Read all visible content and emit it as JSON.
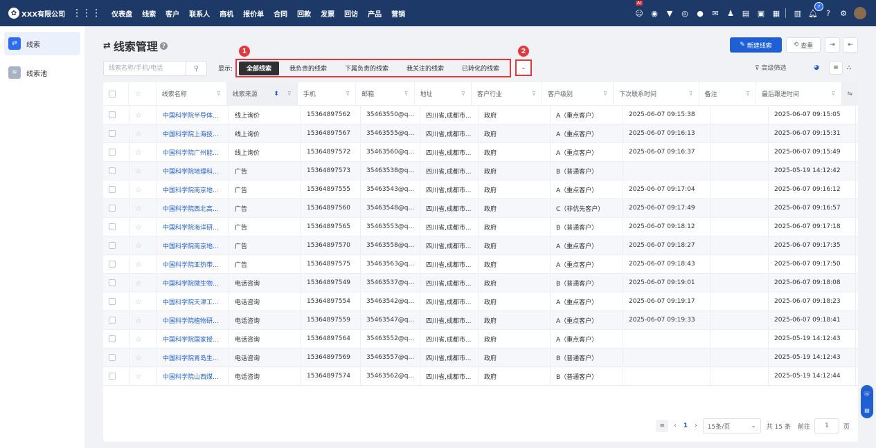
{
  "header": {
    "company": "XXX有限公司",
    "nav": [
      "仪表盘",
      "线索",
      "客户",
      "联系人",
      "商机",
      "报价单",
      "合同",
      "回款",
      "发票",
      "回访",
      "产品",
      "营销"
    ],
    "ai_badge": "AI",
    "notify_count": "7"
  },
  "sidebar": {
    "items": [
      {
        "label": "线索",
        "icon": "clue-icon",
        "active": true
      },
      {
        "label": "线索池",
        "icon": "pool-icon",
        "active": false
      }
    ]
  },
  "page": {
    "title": "线索管理",
    "new_label": "新建线索",
    "check_label": "查重",
    "search_placeholder": "线索名称/手机/电话",
    "display_label": "显示:",
    "advanced_filter": "高级筛选",
    "tabs": [
      "全部线索",
      "我负责的线索",
      "下属负责的线索",
      "我关注的线索",
      "已转化的线索"
    ],
    "marker_1": "1",
    "marker_2": "2"
  },
  "table": {
    "columns": [
      "线索名称",
      "线索来源",
      "手机",
      "邮箱",
      "地址",
      "客户行业",
      "客户级别",
      "下次联系时间",
      "备注",
      "最后跟进时间"
    ],
    "rows": [
      [
        "中国科学院半导体...",
        "线上询价",
        "15364897562",
        "35463550@q...",
        "四川省,成都市...",
        "政府",
        "A（重点客户）",
        "2025-06-07 09:15:38",
        "",
        "2025-06-07 09:15:05"
      ],
      [
        "中国科学院上海技...",
        "线上询价",
        "15364897567",
        "35463555@q...",
        "四川省,成都市...",
        "政府",
        "A（重点客户）",
        "2025-06-07 09:16:13",
        "",
        "2025-06-07 09:15:31"
      ],
      [
        "中国科学院广州能...",
        "线上询价",
        "15364897572",
        "35463560@q...",
        "四川省,成都市...",
        "政府",
        "A（重点客户）",
        "2025-06-07 09:16:37",
        "",
        "2025-06-07 09:15:49"
      ],
      [
        "中国科学院地理科...",
        "广告",
        "15364897573",
        "35463538@q...",
        "四川省,成都市...",
        "政府",
        "B（普通客户）",
        "",
        "",
        "2025-05-19 14:12:42"
      ],
      [
        "中国科学院南京地...",
        "广告",
        "15364897555",
        "35463543@q...",
        "四川省,成都市...",
        "政府",
        "A（重点客户）",
        "2025-06-07 09:17:04",
        "",
        "2025-06-07 09:16:12"
      ],
      [
        "中国科学院西北高...",
        "广告",
        "15364897560",
        "35463548@q...",
        "四川省,成都市...",
        "政府",
        "C（非优先客户）",
        "2025-06-07 09:17:49",
        "",
        "2025-06-07 09:16:57"
      ],
      [
        "中国科学院海洋研...",
        "广告",
        "15364897565",
        "35463553@q...",
        "四川省,成都市...",
        "政府",
        "B（普通客户）",
        "2025-06-07 09:18:12",
        "",
        "2025-06-07 09:17:18"
      ],
      [
        "中国科学院南京地...",
        "广告",
        "15364897570",
        "35463558@q...",
        "四川省,成都市...",
        "政府",
        "A（重点客户）",
        "2025-06-07 09:18:27",
        "",
        "2025-06-07 09:17:35"
      ],
      [
        "中国科学院亚热带...",
        "广告",
        "15364897575",
        "35463563@q...",
        "四川省,成都市...",
        "政府",
        "A（重点客户）",
        "2025-06-07 09:18:43",
        "",
        "2025-06-07 09:17:50"
      ],
      [
        "中国科学院微生物...",
        "电话咨询",
        "15364897549",
        "35463537@q...",
        "四川省,成都市...",
        "政府",
        "B（普通客户）",
        "2025-06-07 09:19:01",
        "",
        "2025-06-07 09:18:08"
      ],
      [
        "中国科学院天津工...",
        "电话咨询",
        "15364897554",
        "35463542@q...",
        "四川省,成都市...",
        "政府",
        "A（重点客户）",
        "2025-06-07 09:19:17",
        "",
        "2025-06-07 09:18:23"
      ],
      [
        "中国科学院植物研...",
        "电话咨询",
        "15364897559",
        "35463547@q...",
        "四川省,成都市...",
        "政府",
        "A（重点客户）",
        "2025-06-07 09:19:33",
        "",
        "2025-06-07 09:18:41"
      ],
      [
        "中国科学院国家授...",
        "电话咨询",
        "15364897564",
        "35463552@q...",
        "四川省,成都市...",
        "政府",
        "A（重点客户）",
        "",
        "",
        "2025-05-19 14:12:43"
      ],
      [
        "中国科学院青岛生...",
        "电话咨询",
        "15364897569",
        "35463557@q...",
        "四川省,成都市...",
        "政府",
        "B（普通客户）",
        "",
        "",
        "2025-05-19 14:12:43"
      ],
      [
        "中国科学院山西煤...",
        "电话咨询",
        "15364897574",
        "35463562@q...",
        "四川省,成都市...",
        "政府",
        "B（普通客户）",
        "",
        "",
        "2025-05-19 14:12:44"
      ]
    ]
  },
  "pagination": {
    "current": "1",
    "page_size": "15条/页",
    "total": "共 15 条",
    "goto_label": "前往",
    "goto_value": "1",
    "page_unit": "页"
  },
  "colors": {
    "topbar": "#1c3967",
    "primary": "#1f5fd6",
    "highlight": "#e4393c"
  }
}
